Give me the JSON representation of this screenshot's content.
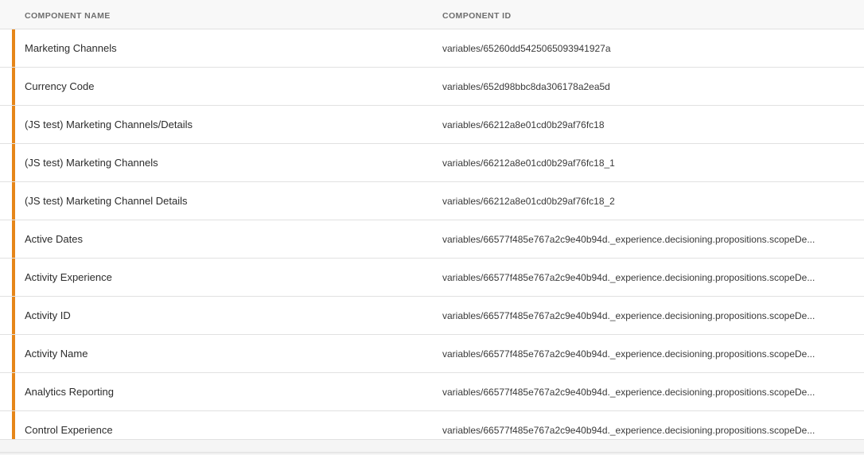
{
  "table": {
    "columns": {
      "name": "COMPONENT NAME",
      "id": "COMPONENT ID"
    },
    "accent_color": "#e68619",
    "rows": [
      {
        "name": "Marketing Channels",
        "id": "variables/65260dd5425065093941927a"
      },
      {
        "name": "Currency Code",
        "id": "variables/652d98bbc8da306178a2ea5d"
      },
      {
        "name": "(JS test) Marketing Channels/Details",
        "id": "variables/66212a8e01cd0b29af76fc18"
      },
      {
        "name": "(JS test) Marketing Channels",
        "id": "variables/66212a8e01cd0b29af76fc18_1"
      },
      {
        "name": "(JS test) Marketing Channel Details",
        "id": "variables/66212a8e01cd0b29af76fc18_2"
      },
      {
        "name": "Active Dates",
        "id": "variables/66577f485e767a2c9e40b94d._experience.decisioning.propositions.scopeDe..."
      },
      {
        "name": "Activity Experience",
        "id": "variables/66577f485e767a2c9e40b94d._experience.decisioning.propositions.scopeDe..."
      },
      {
        "name": "Activity ID",
        "id": "variables/66577f485e767a2c9e40b94d._experience.decisioning.propositions.scopeDe..."
      },
      {
        "name": "Activity Name",
        "id": "variables/66577f485e767a2c9e40b94d._experience.decisioning.propositions.scopeDe..."
      },
      {
        "name": "Analytics Reporting",
        "id": "variables/66577f485e767a2c9e40b94d._experience.decisioning.propositions.scopeDe..."
      },
      {
        "name": "Control Experience",
        "id": "variables/66577f485e767a2c9e40b94d._experience.decisioning.propositions.scopeDe..."
      }
    ]
  }
}
